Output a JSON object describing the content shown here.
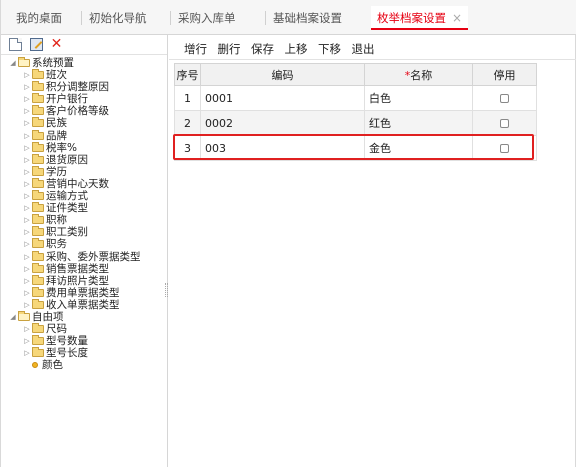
{
  "tabs": [
    {
      "label": "我的桌面"
    },
    {
      "label": "初始化导航"
    },
    {
      "label": "采购入库单"
    },
    {
      "label": "基础档案设置"
    },
    {
      "label": "枚举档案设置",
      "active": true,
      "close": "×"
    }
  ],
  "left_toolbar": {
    "icons": [
      "new-file-icon",
      "edit-icon",
      "delete-icon"
    ],
    "delete_glyph": "✕"
  },
  "tree": {
    "root1": "系统预置",
    "root1_children": [
      "班次",
      "积分调整原因",
      "开户银行",
      "客户价格等级",
      "民族",
      "品牌",
      "税率%",
      "退货原因",
      "学历",
      "营销中心天数",
      "运输方式",
      "证件类型",
      "职称",
      "职工类别",
      "职务",
      "采购、委外票据类型",
      "销售票据类型",
      "拜访照片类型",
      "费用单票据类型",
      "收入单票据类型"
    ],
    "root2": "自由项",
    "root2_children": [
      "尺码",
      "型号数量",
      "型号长度"
    ],
    "root2_leaf": "颜色"
  },
  "actions": [
    "增行",
    "删行",
    "保存",
    "上移",
    "下移",
    "退出"
  ],
  "grid": {
    "headers": {
      "seq": "序号",
      "code": "编码",
      "name_required_mark": "*",
      "name": "名称",
      "disabled": "停用"
    },
    "rows": [
      {
        "seq": "1",
        "code": "0001",
        "name": "白色",
        "disabled": false
      },
      {
        "seq": "2",
        "code": "0002",
        "name": "红色",
        "disabled": false
      },
      {
        "seq": "3",
        "code": "003",
        "name": "金色",
        "disabled": false
      }
    ]
  },
  "colors": {
    "accent": "#e60012",
    "highlight_border": "#e02020",
    "folder": "#f6d77a"
  }
}
